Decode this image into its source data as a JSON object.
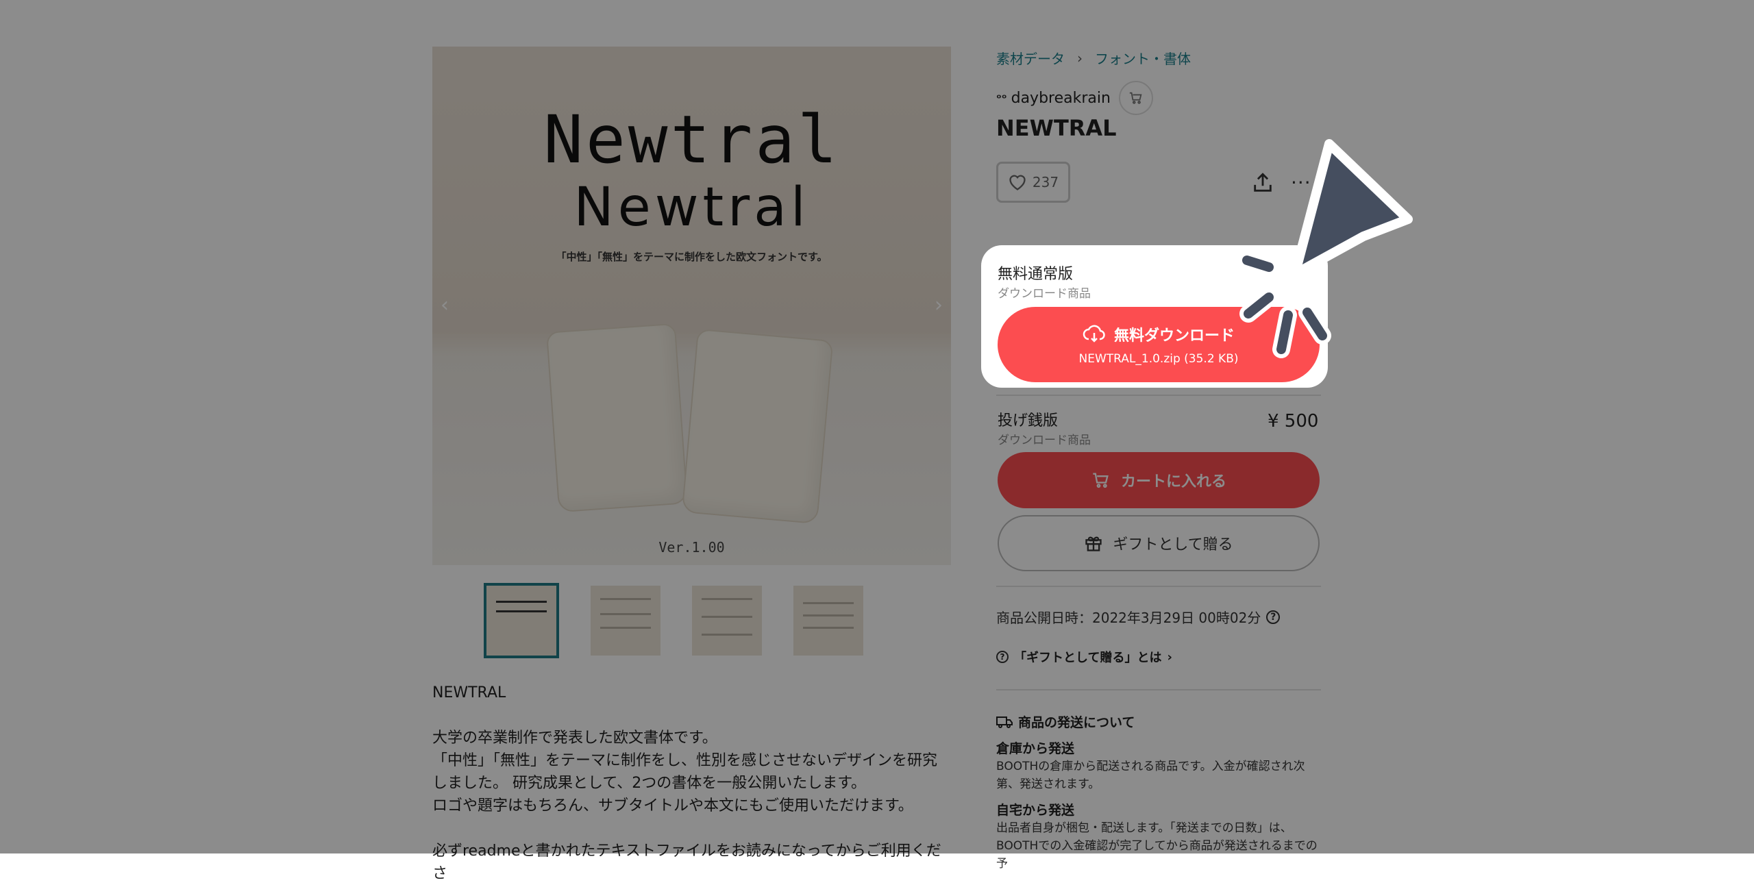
{
  "image": {
    "title1": "Newtral",
    "title2": "Newtral",
    "subtitle": "「中性」「無性」をテーマに制作をした欧文フォントです。",
    "version": "Ver.1.00"
  },
  "breadcrumb": {
    "items": [
      "素材データ",
      "フォント・書体"
    ]
  },
  "shop": {
    "name": "daybreakrain"
  },
  "product": {
    "title": "NEWTRAL"
  },
  "like": {
    "count": "237"
  },
  "variants": {
    "free": {
      "name": "無料通常版",
      "type": "ダウンロード商品",
      "button_label": "無料ダウンロード",
      "file": "NEWTRAL_1.0.zip (35.2 KB)"
    },
    "paid": {
      "name": "投げ銭版",
      "type": "ダウンロード商品",
      "price": "¥ 500",
      "cart_label": "カートに入れる",
      "gift_label": "ギフトとして贈る"
    }
  },
  "publish_date": "商品公開日時：2022年3月29日 00時02分",
  "gift_help": "「ギフトとして贈る」とは",
  "shipping": {
    "title": "商品の発送について",
    "warehouse_title": "倉庫から発送",
    "warehouse_text": "BOOTHの倉庫から配送される商品です。入金が確認され次第、発送されます。",
    "home_title": "自宅から発送",
    "home_text": "出品者自身が梱包・配送します。「発送までの日数」は、BOOTHでの入金確認が完了してから商品が発送されるまでの予"
  },
  "description": {
    "lines": [
      "NEWTRAL",
      "",
      "大学の卒業制作で発表した欧文書体です。",
      "「中性」「無性」をテーマに制作をし、性別を感じさせないデザインを研究",
      "しました。 研究成果として、2つの書体を一般公開いたします。",
      "ロゴや題字はもちろん、サブタイトルや本文にもご使用いただけます。",
      "",
      "必ずreadmeと書かれたテキストファイルをお読みになってからご利用くださ"
    ]
  },
  "colors": {
    "accent": "#fc4d50",
    "link": "#1b7f8a",
    "thumb_active": "#1f7a86"
  }
}
